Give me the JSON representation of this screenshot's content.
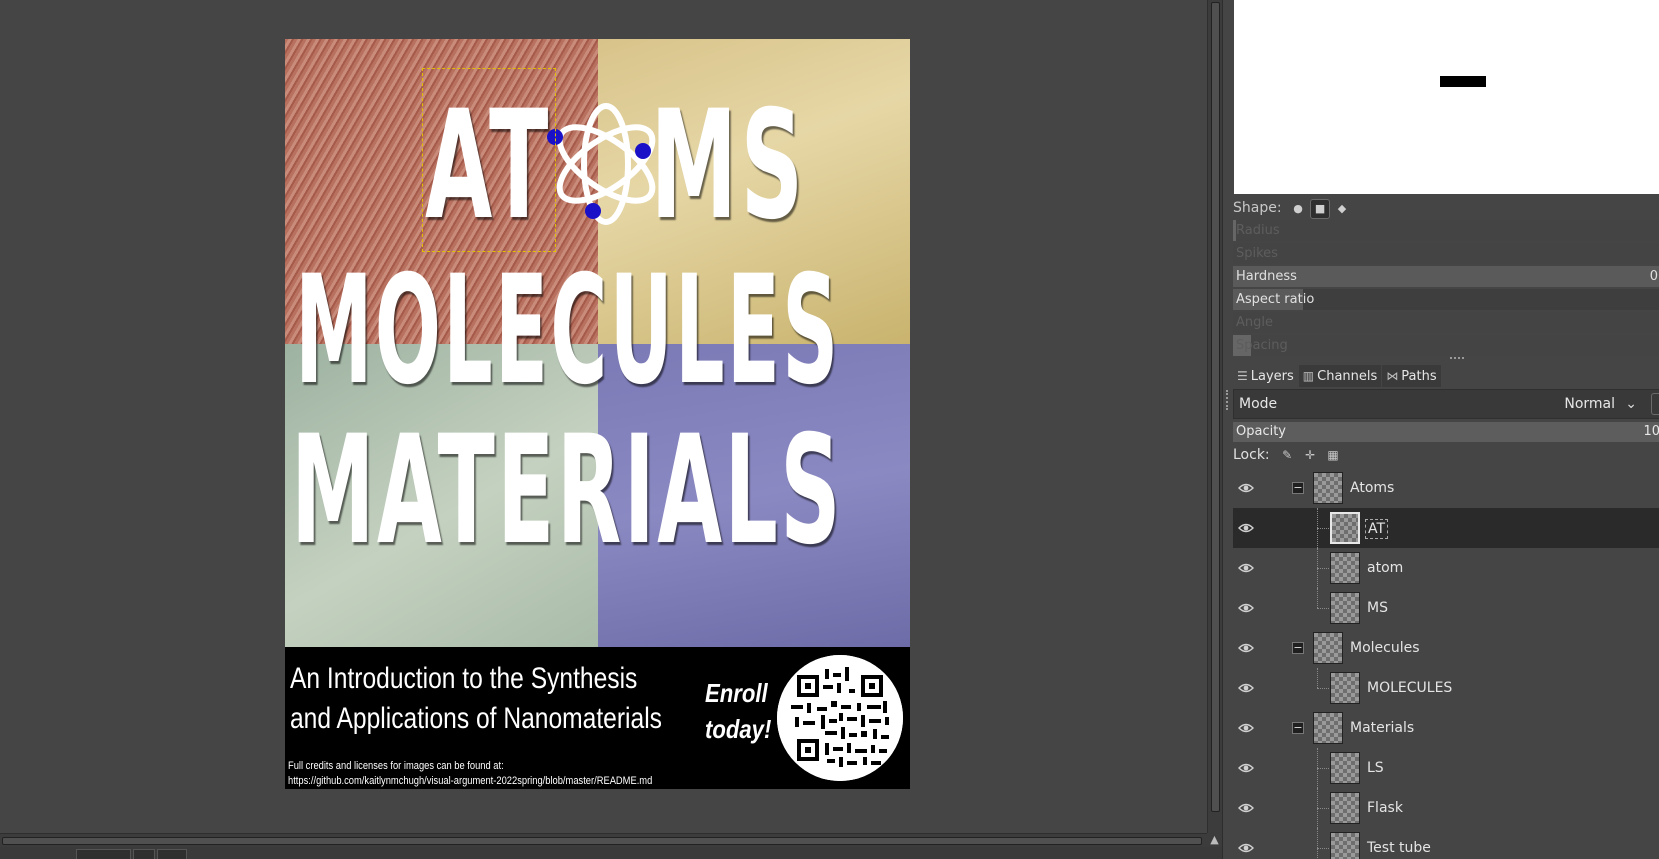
{
  "poster": {
    "word_atoms_left": "AT",
    "word_atoms_right": "MS",
    "word_molecules": "MOLECULES",
    "word_materials": "MATERIALS",
    "subtitle_line1": "An Introduction to the Synthesis",
    "subtitle_line2": "and Applications of Nanomaterials",
    "enroll_line1": "Enroll",
    "enroll_line2": "today!",
    "credits_line1": "Full credits and licenses for images can be found at:",
    "credits_line2": "https://github.com/kaitlynmchugh/visual-argument-2022spring/blob/master/README.md"
  },
  "tool_options": {
    "shape_label": "Shape:",
    "shapes": [
      "circle",
      "square",
      "diamond"
    ],
    "active_shape": "square",
    "radius_label": "Radius",
    "spikes_label": "Spikes",
    "hardness_label": "Hardness",
    "hardness_value": "0",
    "aspect_label": "Aspect ratio",
    "angle_label": "Angle",
    "spacing_label": "Spacing"
  },
  "dock_tabs": [
    {
      "label": "Layers",
      "icon": "layers-icon"
    },
    {
      "label": "Channels",
      "icon": "channels-icon"
    },
    {
      "label": "Paths",
      "icon": "paths-icon"
    }
  ],
  "layers_panel": {
    "mode_label": "Mode",
    "mode_value": "Normal",
    "opacity_label": "Opacity",
    "opacity_value": "10",
    "lock_label": "Lock:",
    "layers": [
      {
        "name": "Atoms",
        "group": true
      },
      {
        "name": "AT",
        "group": false,
        "selected": true
      },
      {
        "name": "atom",
        "group": false
      },
      {
        "name": "MS",
        "group": false
      },
      {
        "name": "Molecules",
        "group": true
      },
      {
        "name": "MOLECULES",
        "group": false
      },
      {
        "name": "Materials",
        "group": true
      },
      {
        "name": "LS",
        "group": false
      },
      {
        "name": "Flask",
        "group": false
      },
      {
        "name": "Test tube",
        "group": false
      }
    ]
  },
  "colors": {
    "background": "#454545",
    "quad_red": "#c98b7a",
    "quad_yellow": "#e6d7a6",
    "quad_green": "#c5d1c0",
    "quad_purple": "#8b89c2",
    "handle_blue": "#1a10c8",
    "selection_yellow": "#e0c000"
  }
}
